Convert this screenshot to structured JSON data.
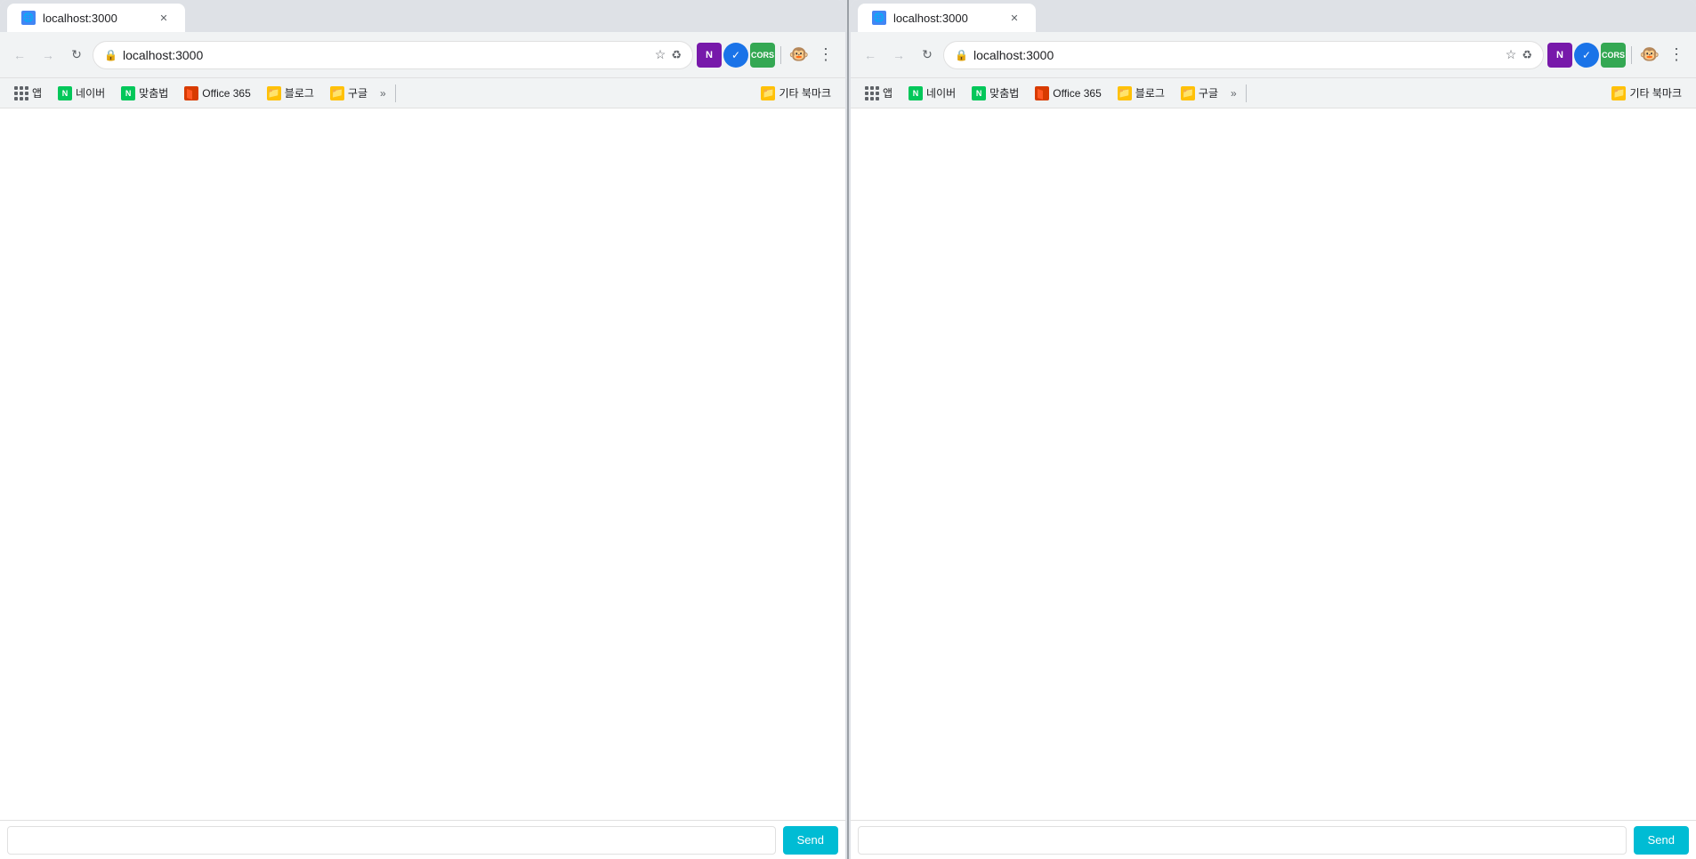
{
  "browser": {
    "url": "localhost:3000",
    "left": {
      "tab_title": "localhost:3000",
      "bookmarks": [
        {
          "id": "apps",
          "type": "apps",
          "label": null
        },
        {
          "id": "naver1",
          "type": "naver",
          "label": "네이버"
        },
        {
          "id": "matchumbeop",
          "type": "naver",
          "label": "맞춤법"
        },
        {
          "id": "office365",
          "type": "office",
          "label": "Office 365"
        },
        {
          "id": "blog",
          "type": "folder",
          "label": "블로그"
        },
        {
          "id": "google",
          "type": "folder",
          "label": "구글"
        }
      ],
      "other_bookmarks": "기타 북마크",
      "send_label": "Send"
    },
    "right": {
      "tab_title": "localhost:3000",
      "bookmarks": [
        {
          "id": "apps",
          "type": "apps",
          "label": null
        },
        {
          "id": "naver1",
          "type": "naver",
          "label": "네이버"
        },
        {
          "id": "matchumbeop",
          "type": "naver",
          "label": "맞춤법"
        },
        {
          "id": "office365",
          "type": "office",
          "label": "Office 365"
        },
        {
          "id": "blog",
          "type": "folder",
          "label": "블로그"
        },
        {
          "id": "google",
          "type": "folder",
          "label": "구글"
        }
      ],
      "other_bookmarks": "기타 북마크",
      "send_label": "Send"
    }
  }
}
